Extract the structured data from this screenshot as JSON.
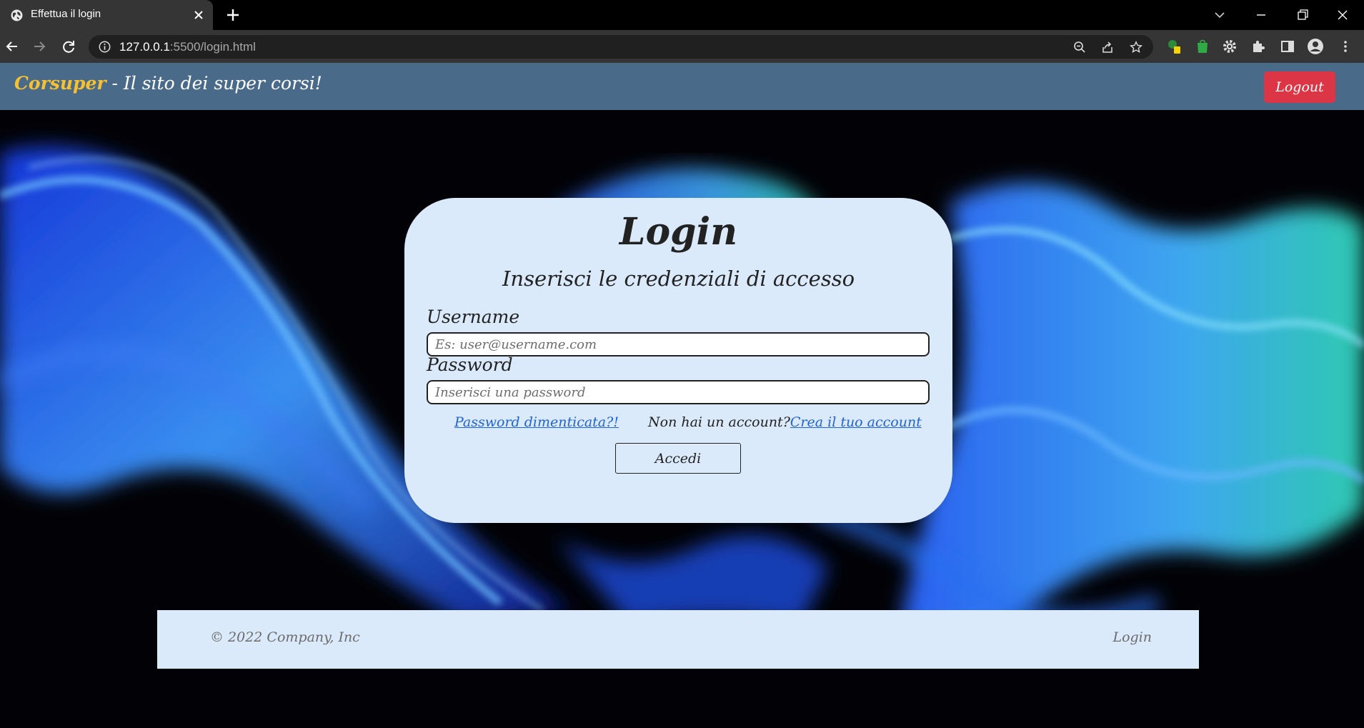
{
  "browser": {
    "tab_title": "Effettua il login",
    "url_host": "127.0.0.1",
    "url_rest": ":5500/login.html"
  },
  "site": {
    "brand_name": "Corsuper",
    "brand_tagline": " - Il sito dei super corsi!",
    "logout_label": "Logout"
  },
  "login": {
    "title": "Login",
    "subtitle": "Inserisci le credenziali di accesso",
    "username_label": "Username",
    "username_placeholder": "Es: user@username.com",
    "password_label": "Password",
    "password_placeholder": "Inserisci una password",
    "forgot_link": "Password dimenticata?!",
    "no_account_text": "Non hai un account?",
    "create_link": "Crea il tuo account",
    "submit_label": "Accedi"
  },
  "footer": {
    "copyright": "© 2022 Company, Inc",
    "link": "Login"
  },
  "colors": {
    "nav_bg": "#4a6a8a",
    "brand_accent": "#f7c02f",
    "logout_bg": "#dc3545",
    "card_bg": "#dbeafb",
    "link": "#1f63d6"
  },
  "icons": {
    "tab_favicon": "globe-icon",
    "tab_close": "close-icon",
    "new_tab": "plus-icon",
    "tab_search": "chevron-down-icon",
    "minimize": "minimize-icon",
    "restore": "restore-icon",
    "close_window": "close-icon",
    "back": "arrow-left-icon",
    "forward": "arrow-right-icon",
    "reload": "reload-icon",
    "site_info": "info-icon",
    "zoom": "zoom-out-icon",
    "share": "share-icon",
    "bookmark": "star-icon",
    "extensions": "puzzle-icon",
    "side_panel": "side-panel-icon",
    "profile": "profile-icon",
    "menu": "kebab-menu-icon"
  }
}
